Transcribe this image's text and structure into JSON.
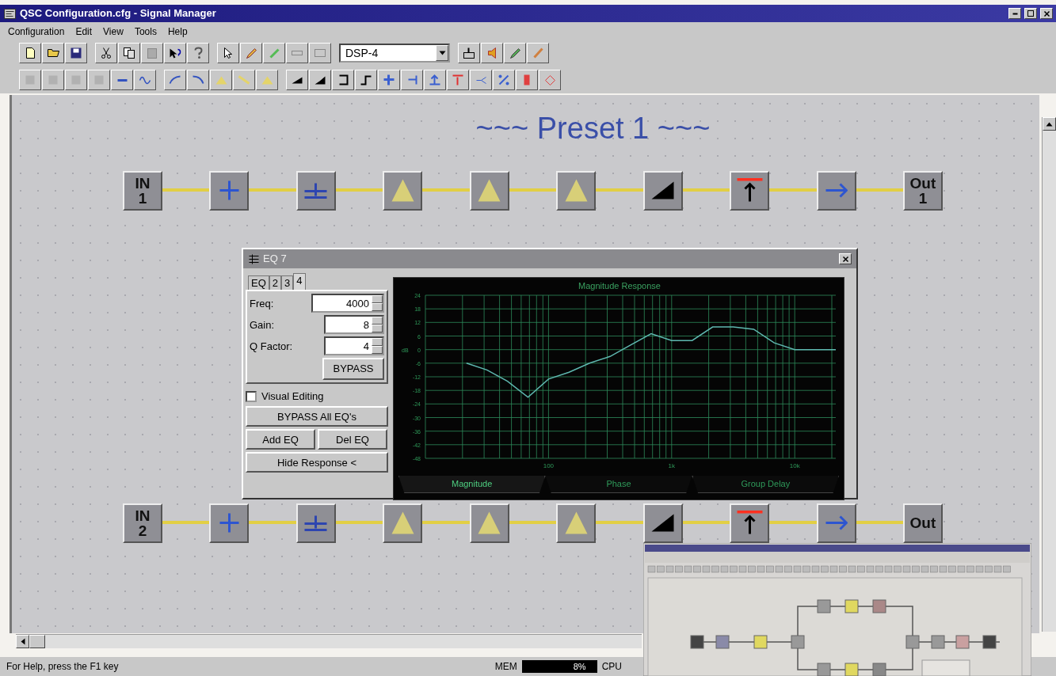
{
  "window": {
    "title": "QSC Configuration.cfg - Signal Manager"
  },
  "menu": [
    "Configuration",
    "Edit",
    "View",
    "Tools",
    "Help"
  ],
  "toolbar": {
    "device": "DSP-4"
  },
  "canvas": {
    "title": "~~~ Preset 1 ~~~",
    "chains": [
      {
        "nodes": [
          {
            "kind": "input",
            "label": "IN",
            "number": "1"
          },
          {
            "kind": "mixer"
          },
          {
            "kind": "eq-bars"
          },
          {
            "kind": "filter"
          },
          {
            "kind": "filter"
          },
          {
            "kind": "filter"
          },
          {
            "kind": "gain"
          },
          {
            "kind": "limiter"
          },
          {
            "kind": "delay"
          },
          {
            "kind": "output",
            "label": "Out",
            "number": "1"
          }
        ]
      },
      {
        "nodes": [
          {
            "kind": "input",
            "label": "IN",
            "number": "2"
          },
          {
            "kind": "mixer"
          },
          {
            "kind": "eq-bars"
          },
          {
            "kind": "filter"
          },
          {
            "kind": "filter"
          },
          {
            "kind": "filter"
          },
          {
            "kind": "gain"
          },
          {
            "kind": "limiter"
          },
          {
            "kind": "delay"
          },
          {
            "kind": "output",
            "label": "Out"
          }
        ]
      }
    ]
  },
  "eq_window": {
    "title": "EQ 7",
    "tabs": [
      {
        "label": "EQ",
        "selected": false
      },
      {
        "label": "2",
        "selected": false
      },
      {
        "label": "3",
        "selected": false
      },
      {
        "label": "4",
        "selected": true
      }
    ],
    "fields": [
      {
        "label": "Freq:",
        "value": "4000"
      },
      {
        "label": "Gain:",
        "value": "8"
      },
      {
        "label": "Q Factor:",
        "value": "4"
      }
    ],
    "bypass": "BYPASS",
    "visual_editing": {
      "label": "Visual Editing",
      "checked": false
    },
    "buttons": [
      {
        "label": "BYPASS All EQ's",
        "kind": "wide"
      },
      {
        "label": "Add EQ",
        "kind": "half"
      },
      {
        "label": "Del EQ",
        "kind": "half"
      },
      {
        "label": "Hide Response <",
        "kind": "wide"
      }
    ],
    "chart_tabs": [
      {
        "label": "Magnitude",
        "selected": true
      },
      {
        "label": "Phase",
        "selected": false
      },
      {
        "label": "Group Delay",
        "selected": false
      }
    ],
    "chart_data": {
      "type": "line",
      "title": "Magnitude Response",
      "ylabel": "dB",
      "categories": [
        null,
        null,
        null,
        null,
        null,
        null,
        "100",
        null,
        null,
        null,
        null,
        null,
        "1k",
        null,
        null,
        null,
        null,
        null,
        "10k",
        null,
        null
      ],
      "series": [
        {
          "color": "#5fb8b0",
          "values": [
            null,
            null,
            -6,
            -9,
            -14,
            -21,
            -13,
            -10,
            -6,
            -3,
            2,
            7,
            4,
            4,
            10,
            10,
            9,
            3,
            0,
            0,
            0
          ]
        }
      ],
      "ylim": [
        -48,
        24
      ],
      "grid": true,
      "yticks": [
        24,
        18,
        12,
        6,
        0,
        -6,
        -12,
        -18,
        -24,
        -30,
        -36,
        -42,
        -48
      ]
    }
  },
  "status_bar": {
    "help": "For Help, press the F1 key",
    "mem": {
      "label": "MEM",
      "reading": "8%"
    },
    "cpu": {
      "label": "CPU"
    }
  }
}
